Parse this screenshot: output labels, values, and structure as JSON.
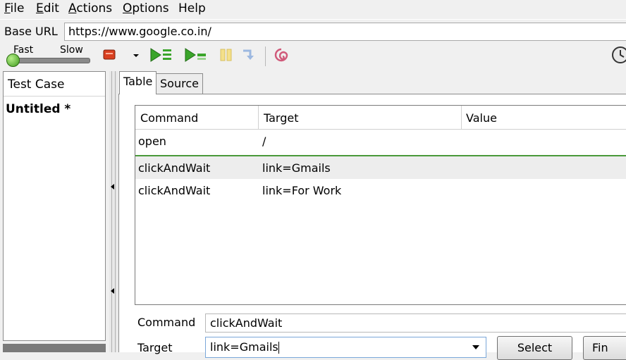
{
  "menu": {
    "file": {
      "u": "F",
      "rest": "ile"
    },
    "edit": {
      "u": "E",
      "rest": "dit"
    },
    "actions": {
      "u": "A",
      "rest": "ctions"
    },
    "options": {
      "u": "O",
      "rest": "ptions"
    },
    "help": {
      "u": "",
      "rest": "Help"
    }
  },
  "url_bar": {
    "label": "Base URL",
    "value": "https://www.google.co.in/"
  },
  "toolbar": {
    "speed_fast": "Fast",
    "speed_slow": "Slow",
    "speed_value": 0.0,
    "icons": [
      "record-icon",
      "dropdown-arrow-icon",
      "play-all-icon",
      "play-current-icon",
      "pause-icon",
      "step-icon",
      "rollup-icon",
      "clock-icon"
    ]
  },
  "test_case_panel": {
    "header": "Test Case",
    "items": [
      "Untitled *"
    ]
  },
  "tabs": {
    "table": "Table",
    "source": "Source",
    "active": "Table"
  },
  "command_table": {
    "columns": [
      "Command",
      "Target",
      "Value"
    ],
    "rows": [
      {
        "command": "open",
        "target": "/",
        "value": ""
      },
      {
        "command": "clickAndWait",
        "target": "link=Gmails",
        "value": ""
      },
      {
        "command": "clickAndWait",
        "target": "link=For Work",
        "value": ""
      }
    ],
    "selected_row": 2
  },
  "editor": {
    "command_label": "Command",
    "command_value": "clickAndWait",
    "target_label": "Target",
    "target_value": "link=Gmails",
    "select_button": "Select",
    "find_button": "Fin"
  },
  "colors": {
    "accent_green": "#3e9a1c",
    "row_separator": "#4a9a3a",
    "record_red": "#d94020"
  }
}
